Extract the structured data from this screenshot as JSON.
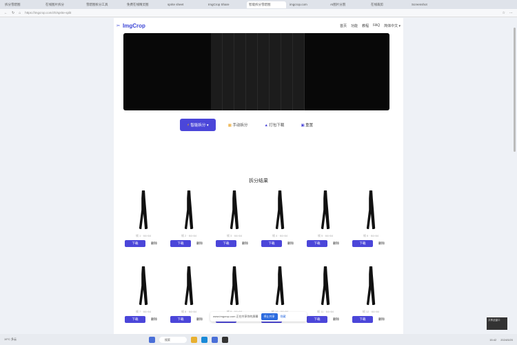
{
  "browser": {
    "tabs": [
      "拆分雪碧图",
      "在线图片拆分",
      "雪碧图拆分工具",
      "免费在线精灵图",
      "sprite sheet",
      "ImgCrop Share",
      "智能拆分雪碧图",
      "imgcrop.com",
      "AI图片分割",
      "在线裁剪",
      "Screenshot"
    ],
    "active_tab": 6,
    "url": "https://imgcrop.com/zh/sprite-split"
  },
  "header": {
    "logo": "ImgCrop",
    "nav": [
      "首页",
      "功能",
      "教程",
      "FAQ"
    ],
    "language": "简体中文 ▾"
  },
  "actions": {
    "smart_split": "智能拆分 ▾",
    "manual_split": "手动拆分",
    "pack_download": "打包下载",
    "reset": "重置"
  },
  "results": {
    "title": "拆分结果",
    "download": "下载",
    "delete": "删除",
    "frames": [
      "帧 1 · 64×64",
      "帧 2 · 64×64",
      "帧 3 · 64×64",
      "帧 4 · 64×64",
      "帧 5 · 64×64",
      "帧 6 · 64×64",
      "帧 7 · 64×64",
      "帧 8 · 64×64",
      "帧 9 · 64×64",
      "帧 10 · 64×64",
      "帧 11 · 64×64",
      "帧 12 · 64×64"
    ]
  },
  "share_bar": {
    "text": "www.imgcrop.com 正在共享你的屏幕",
    "stop": "停止共享",
    "hide": "隐藏"
  },
  "tooltip": "共享此窗口",
  "taskbar": {
    "weather": "19°C 多云",
    "search": "搜索",
    "time": "15:42",
    "date": "2024/5/20"
  }
}
